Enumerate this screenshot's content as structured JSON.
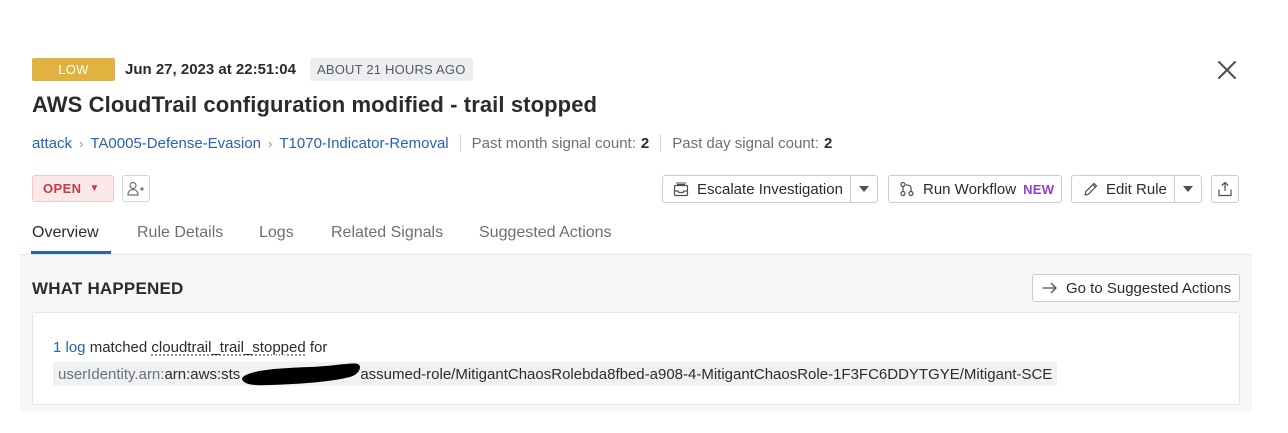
{
  "header": {
    "severity": "LOW",
    "timestamp": "Jun 27, 2023 at 22:51:04",
    "relative_time": "ABOUT 21 HOURS AGO",
    "title": "AWS CloudTrail configuration modified - trail stopped"
  },
  "breadcrumb": {
    "items": [
      "attack",
      "TA0005-Defense-Evasion",
      "T1070-Indicator-Removal"
    ],
    "stats": [
      {
        "label": "Past month signal count:",
        "value": "2"
      },
      {
        "label": "Past day signal count:",
        "value": "2"
      }
    ]
  },
  "actions": {
    "status": "OPEN",
    "escalate_label": "Escalate Investigation",
    "workflow_label": "Run Workflow",
    "workflow_tag": "NEW",
    "edit_rule_label": "Edit Rule"
  },
  "tabs": [
    {
      "label": "Overview",
      "active": true
    },
    {
      "label": "Rule Details",
      "active": false
    },
    {
      "label": "Logs",
      "active": false
    },
    {
      "label": "Related Signals",
      "active": false
    },
    {
      "label": "Suggested Actions",
      "active": false
    }
  ],
  "what_happened": {
    "title": "WHAT HAPPENED",
    "goto_label": "Go to Suggested Actions",
    "log_link": "1 log",
    "matched_text": "matched",
    "rule_ref": "cloudtrail_trail_stopped",
    "for_text": "for",
    "attr_key": "userIdentity.arn:",
    "attr_value_prefix": "arn:aws:sts",
    "attr_value_suffix": "assumed-role/MitigantChaosRolebda8fbed-a908-4-MitigantChaosRole-1F3FC6DDYTGYE/Mitigant-SCE"
  },
  "colors": {
    "severity_low": "#e0b341",
    "status_open": "#c63d46",
    "link": "#2863b0",
    "new_tag": "#8d3fd6"
  },
  "icons": [
    "close-icon",
    "chevron-right-icon",
    "caret-down-icon",
    "assign-user-icon",
    "inbox-icon",
    "workflow-icon",
    "pencil-icon",
    "share-icon",
    "arrow-right-icon"
  ]
}
